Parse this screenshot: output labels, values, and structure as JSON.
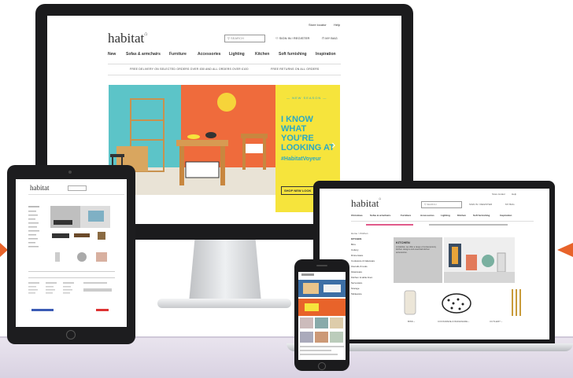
{
  "desktop": {
    "top_links": [
      "Store locator",
      "Help"
    ],
    "logo": "habitat",
    "search_placeholder": "SEARCH",
    "sign_in": "SIGN IN / REGISTER",
    "bag": "MY BAG",
    "nav": [
      "New",
      "Sofas & armchairs",
      "Furniture",
      "Accessories",
      "Lighting",
      "Kitchen",
      "Soft furnishing",
      "Inspiration"
    ],
    "promo_left": "FREE DELIVERY ON SELECTED ORDERS OVER £50 AND ALL ORDERS OVER £100",
    "promo_right": "FREE RETURNS ON ALL ORDERS",
    "hero": {
      "eyebrow": "— NEW SEASON —",
      "headline": [
        "I KNOW",
        "WHAT",
        "YOU'RE",
        "LOOKING AT"
      ],
      "hashtag": "#HabitatVoyeur",
      "cta": "SHOP NEW LOOK"
    }
  },
  "laptop": {
    "logo": "habitat",
    "top_links": [
      "Store locator",
      "Help"
    ],
    "search_placeholder": "SEARCH",
    "sign_in": "SIGN IN / REGISTER",
    "bag": "MY BAG",
    "nav": [
      "Christmas",
      "Sofas & armchairs",
      "Furniture",
      "Accessories",
      "Lighting",
      "Kitchen",
      "Soft furnishing",
      "Inspiration"
    ],
    "breadcrumb": "Home > Kitchen",
    "sidebar_title": "KITCHEN",
    "sidebar_items": [
      "Bins",
      "Cutlery",
      "Dinnerware",
      "Cookware & bakeware",
      "Utensils & tools",
      "Glassware",
      "Kitchen & table linen",
      "Serveware",
      "Storage",
      "Tableware"
    ],
    "feature_title": "KITCHEN",
    "feature_text": "At Habitat, we offer a range of contemporary kitchen designs and essential kitchen accessories.",
    "products": [
      "BINS ›",
      "COOKWARE & BAKEWARE ›",
      "CUTLERY ›"
    ]
  },
  "ipad": {
    "logo": "habitat"
  },
  "colors": {
    "accent_orange": "#e8632a",
    "hero_yellow": "#f6e43c",
    "hero_teal": "#2aa9c5",
    "hero_orange": "#ef6b3c",
    "hero_teal_bg": "#5cc4c8"
  }
}
